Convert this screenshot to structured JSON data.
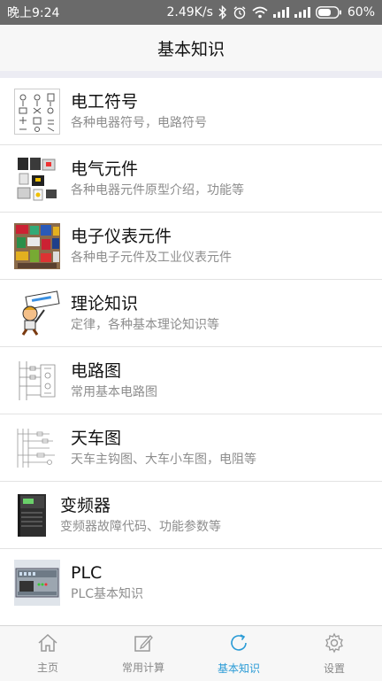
{
  "status_bar": {
    "time": "晚上9:24",
    "speed": "2.49K/s",
    "battery": "60%",
    "icons": [
      "bluetooth-icon",
      "alarm-icon",
      "wifi-icon",
      "signal-icon",
      "signal-icon",
      "battery-icon"
    ]
  },
  "header": {
    "title": "基本知识"
  },
  "list": {
    "items": [
      {
        "title": "电工符号",
        "subtitle": "各种电器符号，电路符号",
        "thumb": "electrical-symbols-thumbnail"
      },
      {
        "title": "电气元件",
        "subtitle": "各种电器元件原型介绍，功能等",
        "thumb": "electrical-components-thumbnail"
      },
      {
        "title": "电子仪表元件",
        "subtitle": "各种电子元件及工业仪表元件",
        "thumb": "electronic-instruments-thumbnail"
      },
      {
        "title": "理论知识",
        "subtitle": "定律，各种基本理论知识等",
        "thumb": "theory-cartoon-thumbnail"
      },
      {
        "title": "电路图",
        "subtitle": "常用基本电路图",
        "thumb": "circuit-diagram-thumbnail"
      },
      {
        "title": "天车图",
        "subtitle": "天车主钩图、大车小车图，电阻等",
        "thumb": "crane-diagram-thumbnail"
      },
      {
        "title": "变频器",
        "subtitle": "变频器故障代码、功能参数等",
        "thumb": "inverter-thumbnail"
      },
      {
        "title": "PLC",
        "subtitle": "PLC基本知识",
        "thumb": "plc-thumbnail"
      }
    ]
  },
  "tabbar": {
    "tabs": [
      {
        "label": "主页",
        "icon": "home-icon"
      },
      {
        "label": "常用计算",
        "icon": "edit-icon"
      },
      {
        "label": "基本知识",
        "icon": "refresh-icon",
        "active": true
      },
      {
        "label": "设置",
        "icon": "gear-icon"
      }
    ]
  },
  "colors": {
    "accent": "#2a9bd6",
    "status_bar": "#6a6a6a",
    "subtitle": "#8d8d8d"
  }
}
